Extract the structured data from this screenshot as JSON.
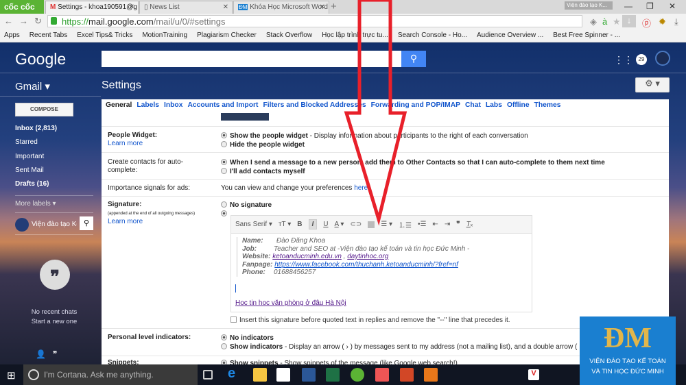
{
  "browser": {
    "brand": "cốc cốc",
    "tabs": [
      {
        "label": "Settings - khoa190591@g",
        "active": true
      },
      {
        "label": "News List"
      },
      {
        "label": "Khóa Học Microsoft Word"
      }
    ],
    "window_title": "Viện đào tạo K...",
    "url_scheme": "https://",
    "url_host": "mail.google.com",
    "url_path": "/mail/u/0/#settings",
    "bookmarks": [
      "Apps",
      "Recent Tabs",
      "Excel Tips& Tricks",
      "MotionTraining",
      "Plagiarism Checker",
      "Stack Overflow",
      "Học lập trình trực tu...",
      "Search Console - Ho...",
      "Audience Overview ...",
      "Best Free Spinner - ..."
    ]
  },
  "gmail": {
    "logo": "Google",
    "notifications": "29",
    "app_label": "Gmail ▾",
    "page_title": "Settings",
    "compose": "COMPOSE",
    "nav": [
      {
        "label": "Inbox (2,813)",
        "bold": true
      },
      {
        "label": "Starred"
      },
      {
        "label": "Important"
      },
      {
        "label": "Sent Mail"
      },
      {
        "label": "Drafts (16)",
        "bold": true
      }
    ],
    "more_labels": "More labels ▾",
    "chat_user": "Viện đào tạo Kế",
    "no_chats": "No recent chats",
    "start_chat": "Start a new one"
  },
  "settings": {
    "tabs": [
      "General",
      "Labels",
      "Inbox",
      "Accounts and Import",
      "Filters and Blocked Addresses",
      "Forwarding and POP/IMAP",
      "Chat",
      "Labs",
      "Offline",
      "Themes"
    ],
    "people_widget": {
      "label": "People Widget:",
      "learn": "Learn more",
      "opt1_b": "Show the people widget",
      "opt1": " - Display information about participants to the right of each conversation",
      "opt2": "Hide the people widget"
    },
    "contacts": {
      "label": "Create contacts for auto-complete:",
      "opt1": "When I send a message to a new person, add them to Other Contacts so that I can auto-complete to them next time",
      "opt2": "I'll add contacts myself"
    },
    "ads": {
      "label": "Importance signals for ads:",
      "text": "You can view and change your preferences ",
      "link": "here."
    },
    "signature": {
      "label": "Signature:",
      "sub": "(appended at the end of all outgoing messages)",
      "learn": "Learn more",
      "none": "No signature",
      "font": "Sans Serif",
      "lines": {
        "name_k": "Name:",
        "name_v": "Đào Đăng Khoa",
        "job_k": "Job:",
        "job_v": "Teacher and SEO at  -Viện đào tạo kế toán và tin học Đức Minh -",
        "web_k": "Website:",
        "web_1": "ketoanducminh.edu.vn",
        "web_sep": " , ",
        "web_2": "daytinhoc.org",
        "fan_k": "Fanpage:",
        "fan_v": "https://www.facebook.com/thuchanh.ketoanducminh/?fref=nf",
        "phone_k": "Phone:",
        "phone_v": "01688456257"
      },
      "link": "Hoc tin hoc văn phòng ở đâu Hà Nội",
      "insert": "Insert this signature before quoted text in replies and remove the \"--\" line that precedes it."
    },
    "indicators": {
      "label": "Personal level indicators:",
      "opt1": "No indicators",
      "opt2_b": "Show indicators",
      "opt2": " - Display an arrow ( › ) by messages sent to my address (not a mailing list), and a double arrow ( » ) by messages sent only to me."
    },
    "snippets": {
      "label": "Snippets:",
      "opt1_b": "Show snippets",
      "opt1": " - Show snippets of the message (like Google web search!)"
    }
  },
  "taskbar": {
    "cortana": "I'm Cortana. Ask me anything."
  },
  "overlay_logo": {
    "mark": "ĐM",
    "line1": "VIỆN ĐÀO TẠO KẾ TOÁN",
    "line2": "VÀ TIN HỌC ĐỨC MINH"
  },
  "colors": {
    "arrow": "#e8202a",
    "link": "#1155cc",
    "search": "#4285f4"
  }
}
